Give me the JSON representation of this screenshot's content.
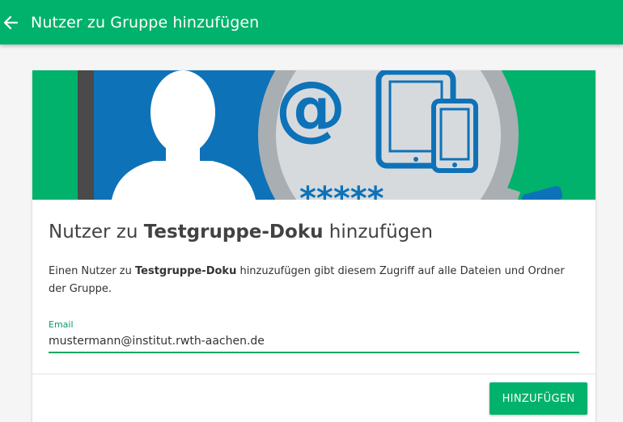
{
  "appbar": {
    "title": "Nutzer zu Gruppe hinzufügen",
    "back_icon": "arrow-left-icon"
  },
  "banner": {
    "icons": [
      "person-silhouette-icon",
      "magnifying-glass-icon",
      "at-sign-icon",
      "tablet-icon",
      "phone-icon"
    ],
    "at_symbol": "@",
    "password_mask": "*****"
  },
  "dialog": {
    "heading_prefix": "Nutzer zu ",
    "heading_group": "Testgruppe-Doku",
    "heading_suffix": " hinzufügen",
    "desc_prefix": "Einen Nutzer zu ",
    "desc_group": "Testgruppe-Doku",
    "desc_suffix": " hinzuzufügen gibt diesem Zugriff auf alle Dateien und Ordner der Gruppe.",
    "email_label": "Email",
    "email_value": "mustermann@institut.rwth-aachen.de",
    "submit_label": "HINZUFÜGEN"
  },
  "colors": {
    "primary": "#00b26b",
    "banner_blue": "#0e72b8",
    "banner_green": "#00b26b"
  }
}
